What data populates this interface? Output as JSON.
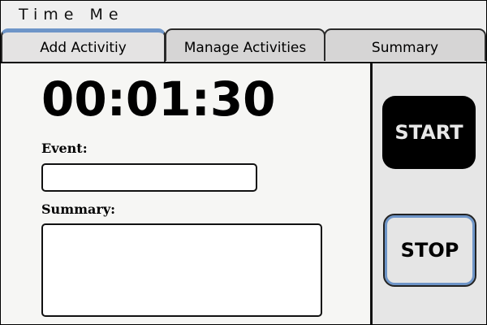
{
  "app": {
    "title": "Time Me"
  },
  "tabs": [
    {
      "label": "Add Activitiy",
      "active": true
    },
    {
      "label": "Manage Activities",
      "active": false
    },
    {
      "label": "Summary",
      "active": false
    }
  ],
  "timer": {
    "display": "00:01:30"
  },
  "form": {
    "event_label": "Event:",
    "event_value": "",
    "summary_label": "Summary:",
    "summary_value": ""
  },
  "controls": {
    "start_label": "START",
    "stop_label": "STOP"
  },
  "colors": {
    "accent": "#6e95c8",
    "start_bg": "#000000",
    "stop_bg": "#e5e5e5"
  }
}
